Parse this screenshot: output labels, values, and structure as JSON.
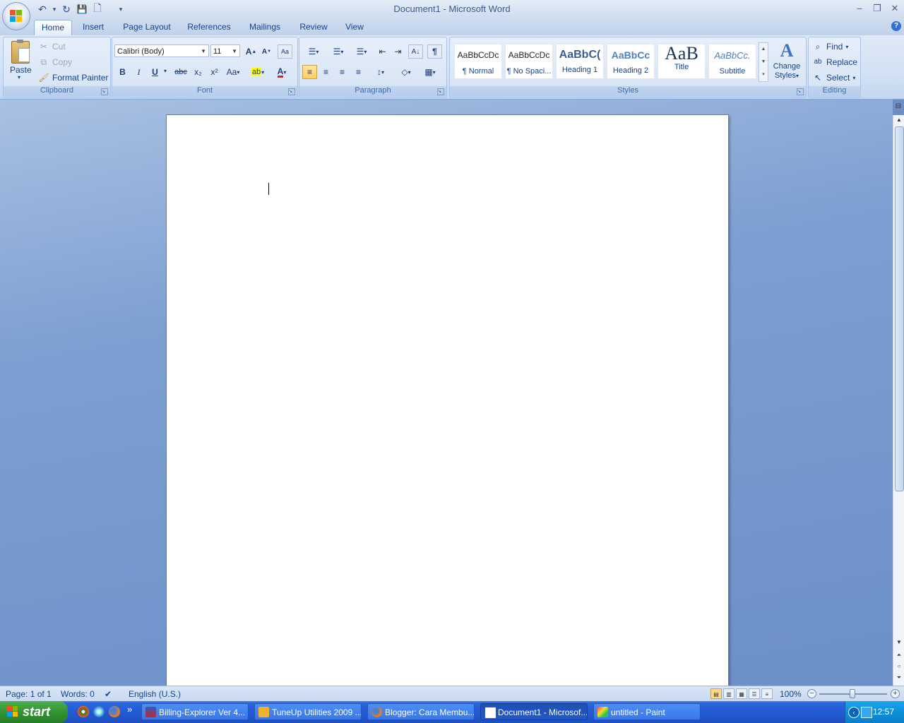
{
  "window": {
    "title": "Document1 - Microsoft Word",
    "minimize": "–",
    "restore": "❐",
    "close": "✕"
  },
  "quick_access": {
    "undo": "↶",
    "redo": "↻",
    "save": "💾",
    "new": "🗋",
    "customize": "▾"
  },
  "tabs": [
    "Home",
    "Insert",
    "Page Layout",
    "References",
    "Mailings",
    "Review",
    "View"
  ],
  "active_tab": "Home",
  "help": "?",
  "clipboard": {
    "label": "Clipboard",
    "paste": "Paste",
    "cut": "Cut",
    "copy": "Copy",
    "format_painter": "Format Painter"
  },
  "font": {
    "label": "Font",
    "family": "Calibri (Body)",
    "size": "11",
    "grow": "A",
    "shrink": "A",
    "clear": "Aa",
    "bold": "B",
    "italic": "I",
    "underline": "U",
    "strikethrough": "abc",
    "subscript": "x₂",
    "superscript": "x²",
    "change_case": "Aa",
    "highlight": "ab",
    "font_color": "A"
  },
  "paragraph": {
    "label": "Paragraph",
    "bullets": "☰",
    "numbering": "☰",
    "multilevel": "☰",
    "decrease_indent": "⇤",
    "increase_indent": "⇥",
    "sort": "A↓",
    "show_marks": "¶",
    "align_left": "≡",
    "center": "≡",
    "align_right": "≡",
    "justify": "≡",
    "line_spacing": "↕",
    "shading": "◇",
    "borders": "▦"
  },
  "styles": {
    "label": "Styles",
    "items": [
      {
        "sample": "AaBbCcDc",
        "name": "¶ Normal"
      },
      {
        "sample": "AaBbCcDc",
        "name": "¶ No Spaci..."
      },
      {
        "sample": "AaBbC(",
        "name": "Heading 1"
      },
      {
        "sample": "AaBbCc",
        "name": "Heading 2"
      },
      {
        "sample": "AaB",
        "name": "Title"
      },
      {
        "sample": "AaBbCc.",
        "name": "Subtitle"
      }
    ],
    "change_styles_1": "Change",
    "change_styles_2": "Styles"
  },
  "editing": {
    "label": "Editing",
    "find": "Find",
    "replace": "Replace",
    "select": "Select"
  },
  "status": {
    "page": "Page: 1 of 1",
    "words": "Words: 0",
    "language": "English (U.S.)",
    "zoom": "100%"
  },
  "taskbar": {
    "start": "start",
    "overflow": "»",
    "tasks": [
      {
        "label": "Billing-Explorer Ver 4...",
        "active": false
      },
      {
        "label": "TuneUp Utilities 2009 ...",
        "active": false
      },
      {
        "label": "Blogger: Cara Membu...",
        "active": false
      },
      {
        "label": "Document1 - Microsof...",
        "active": true
      },
      {
        "label": "untitled - Paint",
        "active": false
      }
    ],
    "clock": "12:57"
  },
  "colors": {
    "accent": "#15428b",
    "ribbon": "#d2e1f4",
    "taskbar": "#245ad3",
    "start_green": "#3a9a3a",
    "font_color_red": "#e02020",
    "highlight_yellow": "#ffff00"
  }
}
